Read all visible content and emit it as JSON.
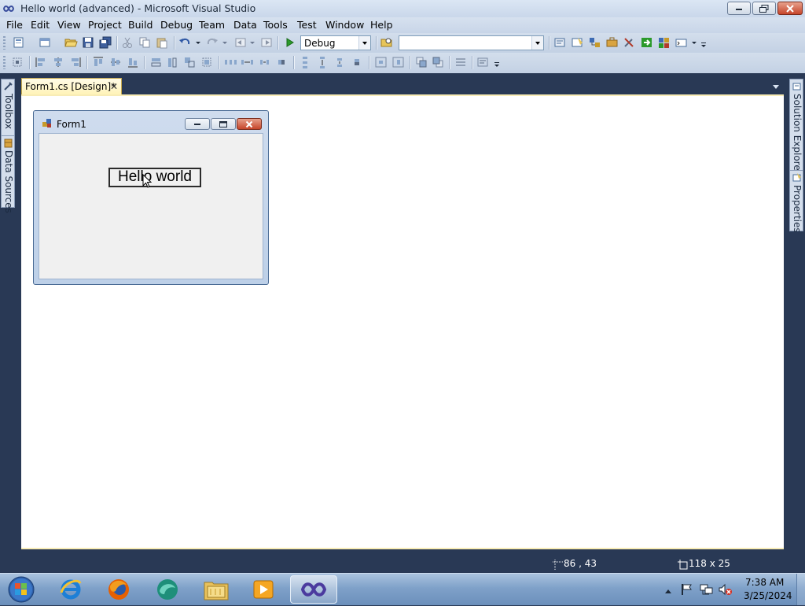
{
  "window": {
    "title": "Hello world (advanced) - Microsoft Visual Studio"
  },
  "menu": [
    "File",
    "Edit",
    "View",
    "Project",
    "Build",
    "Debug",
    "Team",
    "Data",
    "Tools",
    "Test",
    "Window",
    "Help"
  ],
  "toolbar": {
    "config_value": "Debug",
    "platform_value": ""
  },
  "side_tabs": {
    "left": [
      "Toolbox",
      "Data Sources"
    ],
    "right": [
      "Solution Explorer",
      "Properties"
    ]
  },
  "document_tab": {
    "label": "Form1.cs [Design]*",
    "close": "✕"
  },
  "form": {
    "title": "Form1",
    "button_text": "Hello world"
  },
  "status": {
    "position": "86 , 43",
    "size": "118 x 25"
  },
  "taskbar": {
    "time": "7:38 AM",
    "date": "3/25/2024"
  },
  "colors": {
    "chrome": "#293955",
    "design_surface": "#ffffff",
    "tab_active": "#fff3b8"
  }
}
